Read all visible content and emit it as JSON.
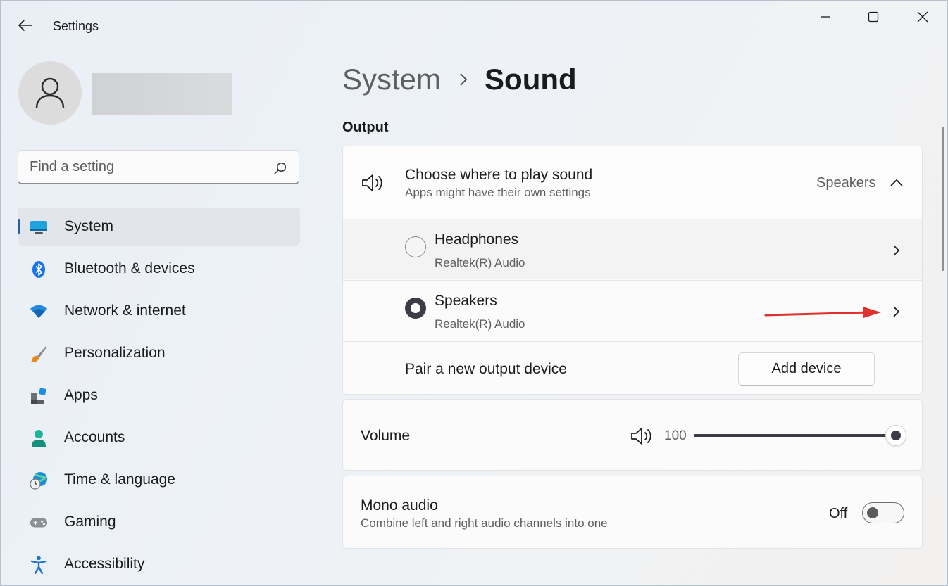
{
  "window": {
    "app_title": "Settings",
    "icons": {
      "back": "back-arrow-icon",
      "minimize": "minimize-icon",
      "maximize": "maximize-icon",
      "close": "close-icon"
    }
  },
  "sidebar": {
    "search": {
      "placeholder": "Find a setting",
      "icon": "search-icon"
    },
    "items": [
      {
        "label": "System",
        "icon": "system-display-icon",
        "active": true
      },
      {
        "label": "Bluetooth & devices",
        "icon": "bluetooth-icon"
      },
      {
        "label": "Network & internet",
        "icon": "wifi-icon"
      },
      {
        "label": "Personalization",
        "icon": "paintbrush-icon"
      },
      {
        "label": "Apps",
        "icon": "apps-icon"
      },
      {
        "label": "Accounts",
        "icon": "accounts-icon"
      },
      {
        "label": "Time & language",
        "icon": "globe-clock-icon"
      },
      {
        "label": "Gaming",
        "icon": "gamepad-icon"
      },
      {
        "label": "Accessibility",
        "icon": "accessibility-icon"
      }
    ]
  },
  "breadcrumb": {
    "parent": "System",
    "current": "Sound"
  },
  "output": {
    "section_title": "Output",
    "choose": {
      "title": "Choose where to play sound",
      "subtitle": "Apps might have their own settings",
      "value": "Speakers",
      "expanded": true
    },
    "devices": [
      {
        "name": "Headphones",
        "driver": "Realtek(R) Audio",
        "selected": false
      },
      {
        "name": "Speakers",
        "driver": "Realtek(R) Audio",
        "selected": true
      }
    ],
    "pair": {
      "label": "Pair a new output device",
      "button": "Add device"
    }
  },
  "volume": {
    "label": "Volume",
    "value": "100",
    "level_percent": 100
  },
  "mono": {
    "title": "Mono audio",
    "subtitle": "Combine left and right audio channels into one",
    "state": "Off"
  },
  "colors": {
    "accent": "#2c5f99",
    "annotation_arrow": "#e03131",
    "slider": "#3a3d45"
  }
}
